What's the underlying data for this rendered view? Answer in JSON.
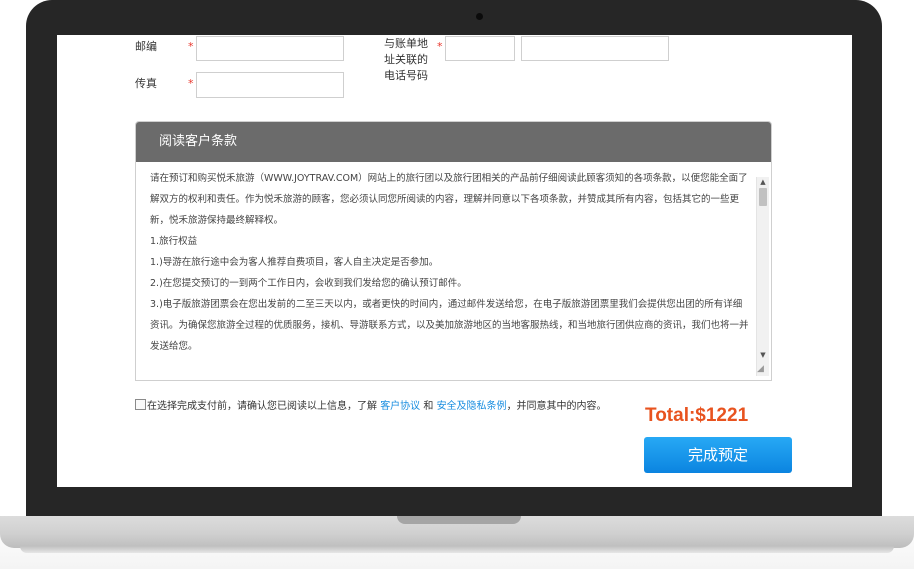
{
  "form": {
    "postcode_label": "邮编",
    "fax_label": "传真",
    "billing_phone_label_line1": "与账单地",
    "billing_phone_label_line2": "址关联的",
    "billing_phone_label_line3": "电话号码",
    "required_mark": "*"
  },
  "terms": {
    "title": "阅读客户条款",
    "paragraphs": [
      "请在预订和购买悦禾旅游（WWW.JOYTRAV.COM）网站上的旅行团以及旅行团相关的产品前仔细阅读此顾客须知的各项条款，以便您能全面了解双方的权利和责任。作为悦禾旅游的顾客，您必须认同您所阅读的内容，理解并同意以下各项条款，并赞成其所有内容，包括其它的一些更新，悦禾旅游保持最终解释权。",
      "1.旅行权益",
      "1.)导游在旅行途中会为客人推荐自费项目，客人自主决定是否参加。",
      "2.)在您提交预订的一到两个工作日内，会收到我们发给您的确认预订邮件。",
      "3.)电子版旅游团票会在您出发前的二至三天以内，或者更快的时间内，通过邮件发送给您，在电子版旅游团票里我们会提供您出团的所有详细资讯。为确保您旅游全过程的优质服务，接机、导游联系方式，以及美加旅游地区的当地客服热线，和当地旅行团供应商的资讯，我们也将一并发送给您。"
    ]
  },
  "agreement": {
    "prefix": "在选择完成支付前，请确认您已阅读以上信息，了解",
    "link1": "客户协议",
    "and": "和",
    "link2": "安全及隐私条例",
    "suffix": "，并同意其中的内容。"
  },
  "total": {
    "text": "Total:$1221"
  },
  "submit": {
    "label": "完成预定"
  },
  "icons": {
    "scroll_up": "triangle-up",
    "scroll_down": "triangle-down",
    "resize": "resize-grip"
  }
}
